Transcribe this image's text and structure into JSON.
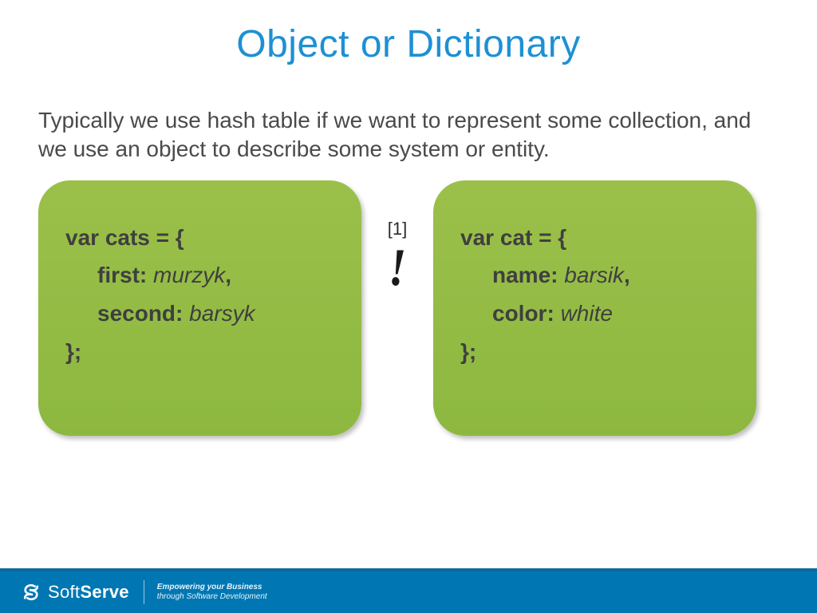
{
  "title": "Object or Dictionary",
  "paragraph": "Typically we use hash table if we want to represent some collection, and we use an object to describe some system or entity.",
  "left_code": {
    "decl": "var cats = {",
    "p1_key": "first:",
    "p1_val": "murzyk",
    "p1_comma": ",",
    "p2_key": "second:",
    "p2_val": "barsyk",
    "close": "};"
  },
  "ref": "[1]",
  "exclaim": "!",
  "right_code": {
    "decl": "var cat = {",
    "p1_key": "name:",
    "p1_val": "barsik",
    "p1_comma": ",",
    "p2_key": "color:",
    "p2_val": "white",
    "close": "};"
  },
  "footer": {
    "brand_thin": "Soft",
    "brand_bold": "Serve",
    "tagline1": "Empowering your Business",
    "tagline2": "through Software Development"
  }
}
